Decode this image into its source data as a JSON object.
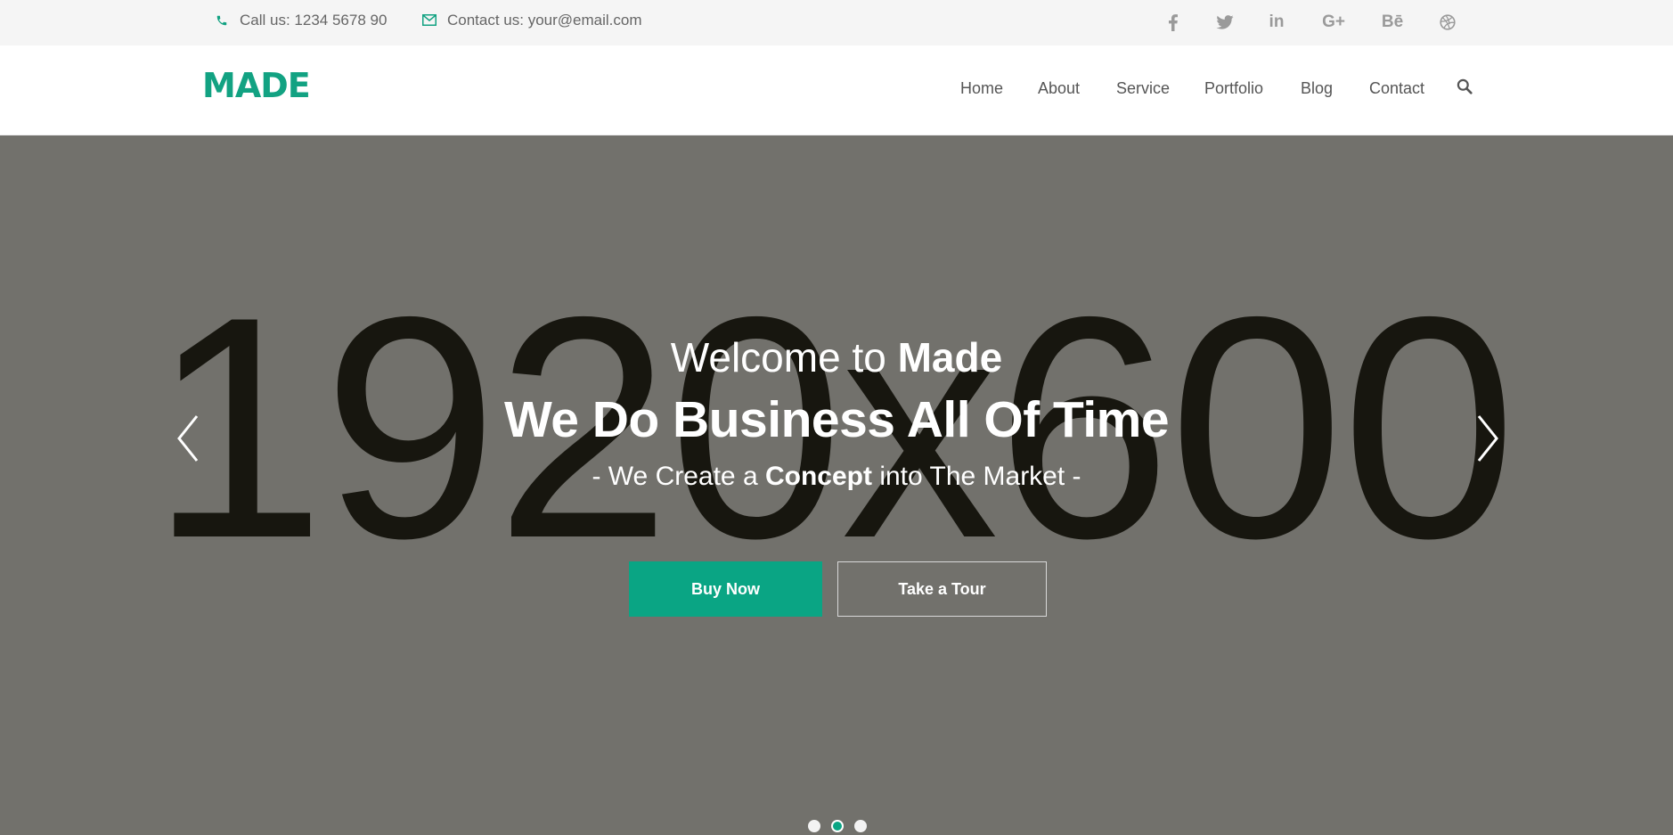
{
  "topbar": {
    "phone": "Call us: 1234 5678 90",
    "email": "Contact us: your@email.com",
    "accent_color": "#12a282",
    "social_icons": [
      "facebook-icon",
      "twitter-icon",
      "linkedin-icon",
      "google-plus-icon",
      "behance-icon",
      "dribbble-icon"
    ],
    "social_labels": {
      "linkedin": "in",
      "google_plus": "G+",
      "behance": "Bē"
    }
  },
  "header": {
    "logo": "MADE",
    "nav": [
      "Home",
      "About",
      "Service",
      "Portfolio",
      "Blog",
      "Contact"
    ],
    "search_icon": "search-icon"
  },
  "hero": {
    "placeholder": "1920x600",
    "welcome_prefix": "Welcome to",
    "welcome_brand": "Made",
    "headline": "We Do Business All Of Time",
    "tagline_prefix": "- We Create a",
    "tagline_bold": "Concept",
    "tagline_suffix": "into The Market -",
    "buttons": {
      "primary": "Buy Now",
      "secondary": "Take a Tour"
    },
    "slides_total": 3,
    "active_slide": 2,
    "colors": {
      "background": "#72716c",
      "button": "#0aa584"
    }
  }
}
